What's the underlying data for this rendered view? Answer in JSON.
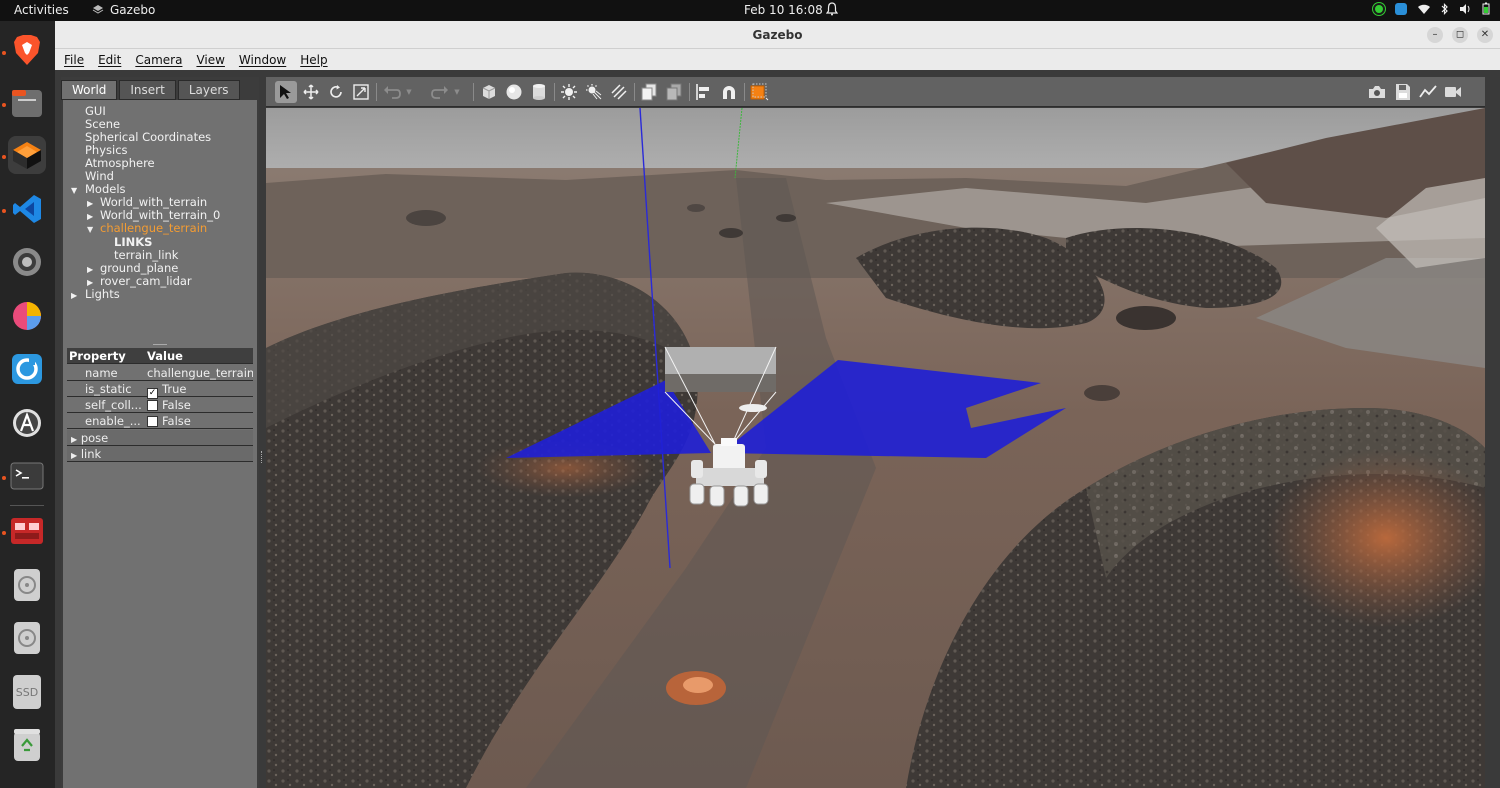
{
  "topbar": {
    "activities": "Activities",
    "app_name": "Gazebo",
    "clock": "Feb 10  16:08"
  },
  "window": {
    "title": "Gazebo"
  },
  "menu": [
    "File",
    "Edit",
    "Camera",
    "View",
    "Window",
    "Help"
  ],
  "tabs": [
    "World",
    "Insert",
    "Layers"
  ],
  "tree": {
    "gui": "GUI",
    "scene": "Scene",
    "spherical": "Spherical Coordinates",
    "physics": "Physics",
    "atmosphere": "Atmosphere",
    "wind": "Wind",
    "models": "Models",
    "model1": "World_with_terrain",
    "model2": "World_with_terrain_0",
    "model3": "challengue_terrain",
    "links": "LINKS",
    "terrain_link": "terrain_link",
    "model4": "ground_plane",
    "model5": "rover_cam_lidar",
    "lights": "Lights"
  },
  "props": {
    "hdr_prop": "Property",
    "hdr_val": "Value",
    "name_k": "name",
    "name_v": "challengue_terrain",
    "static_k": "is_static",
    "static_v": "True",
    "self_k": "self_coll...",
    "self_v": "False",
    "enable_k": "enable_...",
    "enable_v": "False",
    "pose": "pose",
    "link": "link"
  },
  "dock": {
    "ssd_label": "SSD"
  },
  "colors": {
    "lidar_blue": "#1f1fd6",
    "selected_orange": "#f39c33",
    "terrain_brown": "#7a6456"
  }
}
